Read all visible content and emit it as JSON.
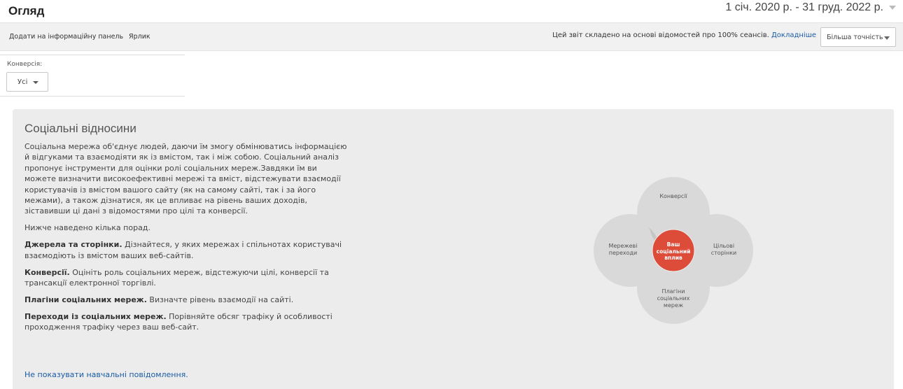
{
  "header": {
    "title": "Огляд",
    "date_range": "1 січ. 2020 р. - 31 груд. 2022 р."
  },
  "toolbar": {
    "add_to_dashboard": "Додати на інформаційну панель",
    "shortcut": "Ярлик",
    "report_note": "Цей звіт складено на основі відомостей про 100% сеансів.",
    "more_link": "Докладніше",
    "precision": "Більша точність"
  },
  "conversion": {
    "label": "Конверсія:",
    "value": "Усі"
  },
  "panel": {
    "title": "Соціальні відносини",
    "intro": "Соціальна мережа об'єднує людей, даючи їм змогу обмінюватись інформацією й відгуками та взаємодіяти як із вмістом, так і між собою. Соціальний аналіз пропонує інструменти для оцінки ролі соціальних мереж.Завдяки їм ви можете визначити високоефективні мережі та вміст, відстежувати взаємодії користувачів із вмістом вашого сайту (як на самому сайті, так і за його межами), а також дізнатися, як це впливає на рівень ваших доходів, зіставивши ці дані з відомостями про цілі та конверсії.",
    "tips_intro": "Нижче наведено кілька порад.",
    "tips": [
      {
        "title": "Джерела та сторінки.",
        "text": "Дізнайтеся, у яких мережах і спільнотах користувачі взаємодіють із вмістом ваших веб-сайтів."
      },
      {
        "title": "Конверсії.",
        "text": "Оцініть роль соціальних мереж, відстежуючи цілі, конверсії та трансакції електронної торгівлі."
      },
      {
        "title": "Плагіни соціальних мереж.",
        "text": "Визначте рівень взаємодії на сайті."
      },
      {
        "title": "Переходи із соціальних мереж.",
        "text": "Порівняйте обсяг трафіку й особливості проходження трафіку через ваш веб-сайт."
      }
    ],
    "hide_link": "Не показувати навчальні повідомлення."
  },
  "diagram": {
    "top": "Конверсії",
    "left": "Мережеві переходи",
    "right": "Цільові сторінки",
    "bottom": "Плагіни соціальних мереж",
    "center": "Ваш соціальний вплив",
    "colors": {
      "petal": "#d9d9d9",
      "overlap": "#c4c4c4",
      "center": "#dd4b39"
    }
  }
}
